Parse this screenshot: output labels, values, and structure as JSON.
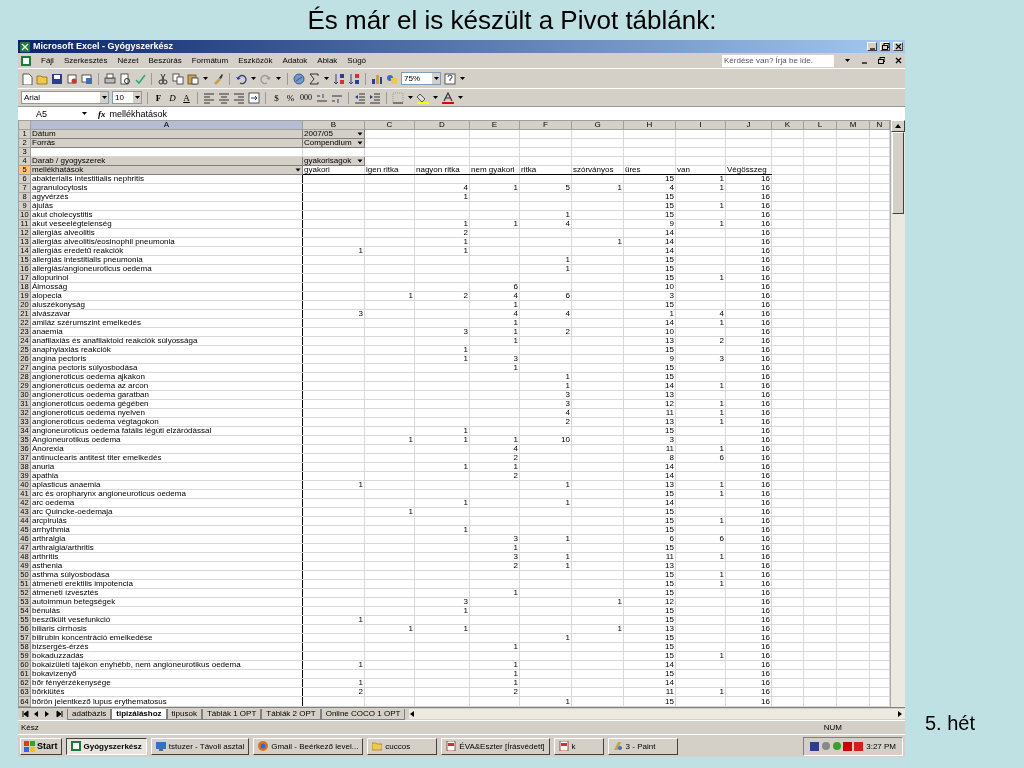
{
  "slide": {
    "title": "És már el is készült a Pivot táblánk:",
    "footer": "5. hét"
  },
  "window": {
    "title": "Microsoft Excel - Gyógyszerkész"
  },
  "menu": [
    "Fájl",
    "Szerkesztés",
    "Nézet",
    "Beszúrás",
    "Formátum",
    "Eszközök",
    "Adatok",
    "Ablak",
    "Súgó"
  ],
  "help_box": {
    "placeholder": "Kérdése van? Írja be ide."
  },
  "standard_toolbar": {
    "zoom": "75%"
  },
  "format_toolbar": {
    "font": "Arial",
    "size": "10",
    "bold": "F",
    "italic": "D",
    "underline": "A",
    "currency": "$",
    "percent": "%",
    "thousands": "000"
  },
  "formula_bar": {
    "cell": "A5",
    "fx": "fx",
    "content": "mellékhatások"
  },
  "columns": [
    {
      "label": "A",
      "selected": true
    },
    {
      "label": "B",
      "selected": false
    },
    {
      "label": "C",
      "selected": false
    },
    {
      "label": "D",
      "selected": false
    },
    {
      "label": "E",
      "selected": false
    },
    {
      "label": "F",
      "selected": false
    },
    {
      "label": "G",
      "selected": false
    },
    {
      "label": "H",
      "selected": false
    },
    {
      "label": "I",
      "selected": false
    },
    {
      "label": "J",
      "selected": false
    },
    {
      "label": "K",
      "selected": false
    },
    {
      "label": "L",
      "selected": false
    },
    {
      "label": "M",
      "selected": false
    },
    {
      "label": "N",
      "selected": false
    }
  ],
  "rows": [
    {
      "kind": "filter",
      "n": "1",
      "selected": false,
      "field": "Dátum",
      "value": "2007/05"
    },
    {
      "kind": "filter",
      "n": "2",
      "selected": false,
      "field": "Forrás",
      "value": "Compendium"
    },
    {
      "kind": "blank",
      "n": "3",
      "selected": false
    },
    {
      "kind": "data_header",
      "n": "4",
      "selected": false,
      "field": "Darab / gyogyszerek",
      "value": "gyakorisagok"
    },
    {
      "kind": "column_items",
      "n": "5",
      "selected": true,
      "field": "mellékhatások",
      "items": [
        "gyakori",
        "igen ritka",
        "nagyon ritka",
        "nem gyakori",
        "ritka",
        "szórványos",
        "üres",
        "van",
        "Végösszeg"
      ]
    },
    {
      "kind": "item",
      "n": "6",
      "selected": false,
      "label": "abakterialis intestitialis nephritis",
      "counts": {
        "ures": "15",
        "van": "1",
        "vegosszeg": "16"
      }
    },
    {
      "kind": "item",
      "n": "7",
      "selected": false,
      "label": "agranulocytosis",
      "counts": {
        "nagyon_ritka": "4",
        "nem_gyakori": "1",
        "ritka": "5",
        "szorvanyos": "1",
        "ures": "4",
        "van": "1",
        "vegosszeg": "16"
      }
    },
    {
      "kind": "item",
      "n": "8",
      "selected": false,
      "label": "agyvérzés",
      "counts": {
        "nagyon_ritka": "1",
        "ures": "15",
        "vegosszeg": "16"
      }
    },
    {
      "kind": "item",
      "n": "9",
      "selected": false,
      "label": "ájulás",
      "counts": {
        "ures": "15",
        "van": "1",
        "vegosszeg": "16"
      }
    },
    {
      "kind": "item",
      "n": "10",
      "selected": false,
      "label": "akut cholecystitis",
      "counts": {
        "ritka": "1",
        "ures": "15",
        "vegosszeg": "16"
      }
    },
    {
      "kind": "item",
      "n": "11",
      "selected": false,
      "label": "akut veseelégtelenség",
      "counts": {
        "nagyon_ritka": "1",
        "nem_gyakori": "1",
        "ritka": "4",
        "ures": "9",
        "van": "1",
        "vegosszeg": "16"
      }
    },
    {
      "kind": "item",
      "n": "12",
      "selected": false,
      "label": "allergiás alveolitis",
      "counts": {
        "nagyon_ritka": "2",
        "ures": "14",
        "vegosszeg": "16"
      }
    },
    {
      "kind": "item",
      "n": "13",
      "selected": false,
      "label": "allergiás alveolitis/eosinophil pneumonia",
      "counts": {
        "nagyon_ritka": "1",
        "szorvanyos": "1",
        "ures": "14",
        "vegosszeg": "16"
      }
    },
    {
      "kind": "item",
      "n": "14",
      "selected": false,
      "label": "allergiás eredetű reakciók",
      "counts": {
        "gyakori": "1",
        "nagyon_ritka": "1",
        "ures": "14",
        "vegosszeg": "16"
      }
    },
    {
      "kind": "item",
      "n": "15",
      "selected": false,
      "label": "allergiás intestitialis pneumonia",
      "counts": {
        "ritka": "1",
        "ures": "15",
        "vegosszeg": "16"
      }
    },
    {
      "kind": "item",
      "n": "16",
      "selected": false,
      "label": "allergiás/angioneuroticus oedema",
      "counts": {
        "ritka": "1",
        "ures": "15",
        "vegosszeg": "16"
      }
    },
    {
      "kind": "item",
      "n": "17",
      "selected": false,
      "label": "allopurinol",
      "counts": {
        "ures": "15",
        "van": "1",
        "vegosszeg": "16"
      }
    },
    {
      "kind": "item",
      "n": "18",
      "selected": false,
      "label": "Álmosság",
      "counts": {
        "nem_gyakori": "6",
        "ures": "10",
        "vegosszeg": "16"
      }
    },
    {
      "kind": "item",
      "n": "19",
      "selected": false,
      "label": "alopecia",
      "counts": {
        "igen_ritka": "1",
        "nagyon_ritka": "2",
        "nem_gyakori": "4",
        "ritka": "6",
        "ures": "3",
        "vegosszeg": "16"
      }
    },
    {
      "kind": "item",
      "n": "20",
      "selected": false,
      "label": "aluszékonyság",
      "counts": {
        "nem_gyakori": "1",
        "ures": "15",
        "vegosszeg": "16"
      }
    },
    {
      "kind": "item",
      "n": "21",
      "selected": false,
      "label": "alvászavar",
      "counts": {
        "gyakori": "3",
        "nem_gyakori": "4",
        "ritka": "4",
        "ures": "1",
        "van": "4",
        "vegosszeg": "16"
      }
    },
    {
      "kind": "item",
      "n": "22",
      "selected": false,
      "label": "amiláz szérumszint emelkedés",
      "counts": {
        "nem_gyakori": "1",
        "ures": "14",
        "van": "1",
        "vegosszeg": "16"
      }
    },
    {
      "kind": "item",
      "n": "23",
      "selected": false,
      "label": "anaemia",
      "counts": {
        "nagyon_ritka": "3",
        "nem_gyakori": "1",
        "ritka": "2",
        "ures": "10",
        "vegosszeg": "16"
      }
    },
    {
      "kind": "item",
      "n": "24",
      "selected": false,
      "label": "anafilaxiás és anafilaktoid reakciók súlyossága",
      "counts": {
        "nem_gyakori": "1",
        "ures": "13",
        "van": "2",
        "vegosszeg": "16"
      }
    },
    {
      "kind": "item",
      "n": "25",
      "selected": false,
      "label": "anaphylaxiás reakciók",
      "counts": {
        "nagyon_ritka": "1",
        "ures": "15",
        "vegosszeg": "16"
      }
    },
    {
      "kind": "item",
      "n": "26",
      "selected": false,
      "label": "angina pectoris",
      "counts": {
        "nagyon_ritka": "1",
        "nem_gyakori": "3",
        "ures": "9",
        "van": "3",
        "vegosszeg": "16"
      }
    },
    {
      "kind": "item",
      "n": "27",
      "selected": false,
      "label": "angina pectoris súlyosbodása",
      "counts": {
        "nem_gyakori": "1",
        "ures": "15",
        "vegosszeg": "16"
      }
    },
    {
      "kind": "item",
      "n": "28",
      "selected": false,
      "label": "angioneroticus oedema ajkakon",
      "counts": {
        "ritka": "1",
        "ures": "15",
        "vegosszeg": "16"
      }
    },
    {
      "kind": "item",
      "n": "29",
      "selected": false,
      "label": "angioneroticus oedema az arcon",
      "counts": {
        "ritka": "1",
        "ures": "14",
        "van": "1",
        "vegosszeg": "16"
      }
    },
    {
      "kind": "item",
      "n": "30",
      "selected": false,
      "label": "angioneroticus oedema garatban",
      "counts": {
        "ritka": "3",
        "ures": "13",
        "vegosszeg": "16"
      }
    },
    {
      "kind": "item",
      "n": "31",
      "selected": false,
      "label": "angioneroticus oedema gégében",
      "counts": {
        "ritka": "3",
        "ures": "12",
        "van": "1",
        "vegosszeg": "16"
      }
    },
    {
      "kind": "item",
      "n": "32",
      "selected": false,
      "label": "angioneroticus oedema nyelven",
      "counts": {
        "ritka": "4",
        "ures": "11",
        "van": "1",
        "vegosszeg": "16"
      }
    },
    {
      "kind": "item",
      "n": "33",
      "selected": false,
      "label": "angioneroticus oedema végtagokon",
      "counts": {
        "ritka": "2",
        "ures": "13",
        "van": "1",
        "vegosszeg": "16"
      }
    },
    {
      "kind": "item",
      "n": "34",
      "selected": false,
      "label": "angioneuroticus oedema fatális légúti elzáródással",
      "counts": {
        "nagyon_ritka": "1",
        "ures": "15",
        "vegosszeg": "16"
      }
    },
    {
      "kind": "item",
      "n": "35",
      "selected": false,
      "label": "Angioneurotikus oedema",
      "counts": {
        "igen_ritka": "1",
        "nagyon_ritka": "1",
        "nem_gyakori": "1",
        "ritka": "10",
        "ures": "3",
        "vegosszeg": "16"
      }
    },
    {
      "kind": "item",
      "n": "36",
      "selected": false,
      "label": "Anorexia",
      "counts": {
        "nem_gyakori": "4",
        "ures": "11",
        "van": "1",
        "vegosszeg": "16"
      }
    },
    {
      "kind": "item",
      "n": "37",
      "selected": false,
      "label": "antinuclearis antitest titer emelkedés",
      "counts": {
        "nem_gyakori": "2",
        "ures": "8",
        "van": "6",
        "vegosszeg": "16"
      }
    },
    {
      "kind": "item",
      "n": "38",
      "selected": false,
      "label": "anuria",
      "counts": {
        "nagyon_ritka": "1",
        "nem_gyakori": "1",
        "ures": "14",
        "vegosszeg": "16"
      }
    },
    {
      "kind": "item",
      "n": "39",
      "selected": false,
      "label": "apathia",
      "counts": {
        "nem_gyakori": "2",
        "ures": "14",
        "vegosszeg": "16"
      }
    },
    {
      "kind": "item",
      "n": "40",
      "selected": false,
      "label": "aplasticus anaemia",
      "counts": {
        "gyakori": "1",
        "ritka": "1",
        "ures": "13",
        "van": "1",
        "vegosszeg": "16"
      }
    },
    {
      "kind": "item",
      "n": "41",
      "selected": false,
      "label": "arc és oropharynx angioneuroticus oedema",
      "counts": {
        "ures": "15",
        "van": "1",
        "vegosszeg": "16"
      }
    },
    {
      "kind": "item",
      "n": "42",
      "selected": false,
      "label": "arc oedema",
      "counts": {
        "nagyon_ritka": "1",
        "ritka": "1",
        "ures": "14",
        "vegosszeg": "16"
      }
    },
    {
      "kind": "item",
      "n": "43",
      "selected": false,
      "label": "arc Quincke-oedemaja",
      "counts": {
        "igen_ritka": "1",
        "ures": "15",
        "vegosszeg": "16"
      }
    },
    {
      "kind": "item",
      "n": "44",
      "selected": false,
      "label": "arcpirulás",
      "counts": {
        "ures": "15",
        "van": "1",
        "vegosszeg": "16"
      }
    },
    {
      "kind": "item",
      "n": "45",
      "selected": false,
      "label": "arrhythmia",
      "counts": {
        "nagyon_ritka": "1",
        "ures": "15",
        "vegosszeg": "16"
      }
    },
    {
      "kind": "item",
      "n": "46",
      "selected": false,
      "label": "arthralgia",
      "counts": {
        "nem_gyakori": "3",
        "ritka": "1",
        "ures": "6",
        "van": "6",
        "vegosszeg": "16"
      }
    },
    {
      "kind": "item",
      "n": "47",
      "selected": false,
      "label": "arthralgia/arthritis",
      "counts": {
        "nem_gyakori": "1",
        "ures": "15",
        "vegosszeg": "16"
      }
    },
    {
      "kind": "item",
      "n": "48",
      "selected": false,
      "label": "arthritis",
      "counts": {
        "nem_gyakori": "3",
        "ritka": "1",
        "ures": "11",
        "van": "1",
        "vegosszeg": "16"
      }
    },
    {
      "kind": "item",
      "n": "49",
      "selected": false,
      "label": "asthenia",
      "counts": {
        "nem_gyakori": "2",
        "ritka": "1",
        "ures": "13",
        "vegosszeg": "16"
      }
    },
    {
      "kind": "item",
      "n": "50",
      "selected": false,
      "label": "asthma súlyosbodása",
      "counts": {
        "ures": "15",
        "van": "1",
        "vegosszeg": "16"
      }
    },
    {
      "kind": "item",
      "n": "51",
      "selected": false,
      "label": "átmeneti erektilis impotencia",
      "counts": {
        "ures": "15",
        "van": "1",
        "vegosszeg": "16"
      }
    },
    {
      "kind": "item",
      "n": "52",
      "selected": false,
      "label": "átmeneti ízvesztés",
      "counts": {
        "nem_gyakori": "1",
        "ures": "15",
        "vegosszeg": "16"
      }
    },
    {
      "kind": "item",
      "n": "53",
      "selected": false,
      "label": "autoimmun betegségek",
      "counts": {
        "nagyon_ritka": "3",
        "szorvanyos": "1",
        "ures": "12",
        "vegosszeg": "16"
      }
    },
    {
      "kind": "item",
      "n": "54",
      "selected": false,
      "label": "bénulás",
      "counts": {
        "nagyon_ritka": "1",
        "ures": "15",
        "vegosszeg": "16"
      }
    },
    {
      "kind": "item",
      "n": "55",
      "selected": false,
      "label": "beszűkült vesefunkció",
      "counts": {
        "gyakori": "1",
        "ures": "15",
        "vegosszeg": "16"
      }
    },
    {
      "kind": "item",
      "n": "56",
      "selected": false,
      "label": "biliaris cirrhosis",
      "counts": {
        "igen_ritka": "1",
        "nagyon_ritka": "1",
        "szorvanyos": "1",
        "ures": "13",
        "vegosszeg": "16"
      }
    },
    {
      "kind": "item",
      "n": "57",
      "selected": false,
      "label": "bilirubin koncentráció emelkedése",
      "counts": {
        "ritka": "1",
        "ures": "15",
        "vegosszeg": "16"
      }
    },
    {
      "kind": "item",
      "n": "58",
      "selected": false,
      "label": "bizsergés-érzés",
      "counts": {
        "nem_gyakori": "1",
        "ures": "15",
        "vegosszeg": "16"
      }
    },
    {
      "kind": "item",
      "n": "59",
      "selected": false,
      "label": "bokaduzzadás",
      "counts": {
        "ures": "15",
        "van": "1",
        "vegosszeg": "16"
      }
    },
    {
      "kind": "item",
      "n": "60",
      "selected": false,
      "label": "bokaizületi tájékon enyhébb, nem angioneurotikus oedema",
      "counts": {
        "gyakori": "1",
        "nem_gyakori": "1",
        "ures": "14",
        "vegosszeg": "16"
      }
    },
    {
      "kind": "item",
      "n": "61",
      "selected": false,
      "label": "bokavizenyő",
      "counts": {
        "nem_gyakori": "1",
        "ures": "15",
        "vegosszeg": "16"
      }
    },
    {
      "kind": "item",
      "n": "62",
      "selected": false,
      "label": "bőr fényérzékenysége",
      "counts": {
        "gyakori": "1",
        "nem_gyakori": "1",
        "ures": "14",
        "vegosszeg": "16"
      }
    },
    {
      "kind": "item",
      "n": "63",
      "selected": false,
      "label": "bőrkiütés",
      "counts": {
        "gyakori": "2",
        "nem_gyakori": "2",
        "ures": "11",
        "van": "1",
        "vegosszeg": "16"
      }
    },
    {
      "kind": "item",
      "n": "64",
      "selected": false,
      "label": "bőrön jelentkező lupus erythematosus",
      "counts": {
        "ritka": "1",
        "ures": "15",
        "vegosszeg": "16"
      }
    }
  ],
  "sheet_tabs": [
    {
      "label": "adatbázis",
      "selected": false
    },
    {
      "label": "tipizáláshoz",
      "selected": true
    },
    {
      "label": "tipusok",
      "selected": false
    },
    {
      "label": "Táblák 1 OPT",
      "selected": false
    },
    {
      "label": "Táblák 2 OPT",
      "selected": false
    },
    {
      "label": "Online COCO 1 OPT",
      "selected": false
    }
  ],
  "status_bar": {
    "status": "Kész",
    "num": "NUM"
  },
  "taskbar": {
    "start": "Start",
    "items": [
      {
        "label": "Gyógyszerkész",
        "selected": true
      },
      {
        "label": "tstuzer - Távoli asztal",
        "selected": false
      },
      {
        "label": "Gmail - Beérkező level...",
        "selected": false
      },
      {
        "label": "cuccos",
        "selected": false
      },
      {
        "label": "ÉVA&Eszter [Írásvédett]",
        "selected": false
      },
      {
        "label": "k",
        "selected": false
      },
      {
        "label": "3 - Paint",
        "selected": false
      }
    ],
    "clock": "3:27 PM"
  }
}
